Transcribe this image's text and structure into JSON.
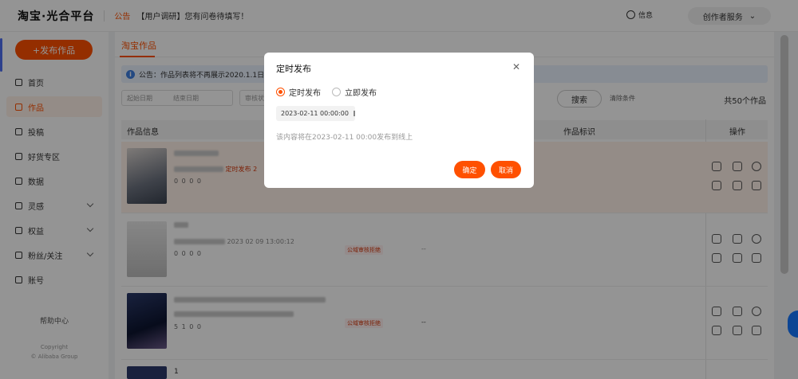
{
  "header": {
    "logo": "淘宝·光合平台",
    "notice_tag": "公告",
    "notice_text": "【用户调研】您有问卷待填写！",
    "message_label": "信息",
    "creator_service": "创作者服务"
  },
  "sidebar": {
    "publish_button": "+发布作品",
    "items": [
      {
        "label": "首页",
        "icon": "home-icon"
      },
      {
        "label": "作品",
        "icon": "works-icon"
      },
      {
        "label": "投稿",
        "icon": "submit-icon"
      },
      {
        "label": "好货专区",
        "icon": "goods-icon"
      },
      {
        "label": "数据",
        "icon": "data-icon"
      },
      {
        "label": "灵感",
        "icon": "bulb-icon"
      },
      {
        "label": "权益",
        "icon": "diamond-icon"
      },
      {
        "label": "粉丝/关注",
        "icon": "fans-icon"
      },
      {
        "label": "账号",
        "icon": "account-icon"
      }
    ],
    "help": "帮助中心",
    "copyright_line1": "Copyright",
    "copyright_line2": "© Alibaba Group"
  },
  "main": {
    "tab": "淘宝作品",
    "info_label": "公告：",
    "info_text": "作品列表将不再展示2020.1.1日之",
    "filters": {
      "start_date": "起始日期",
      "end_date": "结束日期",
      "status": "审核状",
      "search": "搜索",
      "reset": "清除条件",
      "count": "共50个作品"
    },
    "table_headers": {
      "info": "作品信息",
      "tag": "作品标识",
      "ops": "操作"
    },
    "rows": [
      {
        "time": "定时发布 2",
        "stats": "0   0   0   0"
      },
      {
        "time": "2023 02 09 13:00:12",
        "status": "公域审核拒绝",
        "dash": "--",
        "stats": "0   0   0   0"
      },
      {
        "status": "公域审核拒绝",
        "dash": "--",
        "stats": "5   1   0   0"
      },
      {
        "title": "1"
      }
    ]
  },
  "modal": {
    "title": "定时发布",
    "option_scheduled": "定时发布",
    "option_immediate": "立即发布",
    "datetime": "2023-02-11 00:00:00",
    "hint": "该内容将在2023-02-11 00:00发布到线上",
    "ok": "确定",
    "cancel": "取消",
    "close_icon": "close-icon"
  }
}
